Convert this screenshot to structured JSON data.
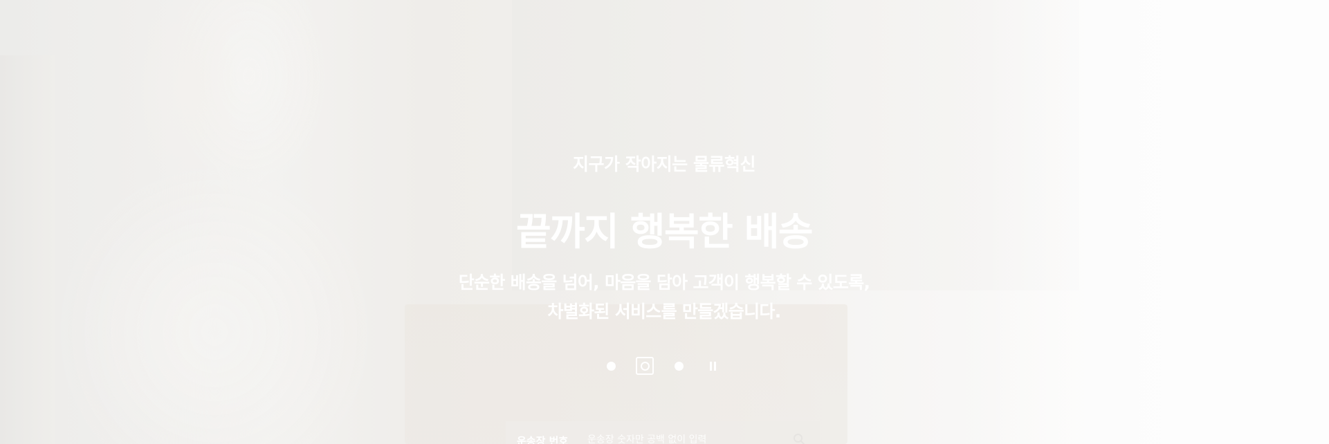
{
  "hero": {
    "subtitle": "지구가 작아지는 물류혁신",
    "headline": "끝까지 행복한 배송",
    "description_lines": [
      "단순한 배송을 넘어, 마음을 담아 고객이 행복할 수 있도록,",
      "차별화된 서비스를 만들겠습니다."
    ]
  },
  "pager": {
    "slide_count": 3,
    "active_index": 1,
    "pause_icon": "pause-icon"
  },
  "tracking": {
    "label": "운송장 번호",
    "placeholder": "운송장 숫자만 공백 없이 입력",
    "search_icon": "search-icon"
  },
  "colors": {
    "text": "#ffffff",
    "background_light": "#f4f3f1"
  }
}
